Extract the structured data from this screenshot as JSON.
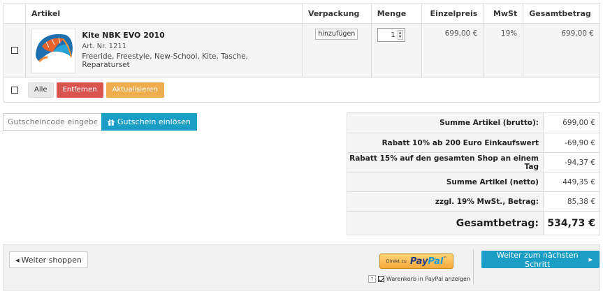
{
  "table": {
    "headers": {
      "article": "Artikel",
      "packaging": "Verpackung",
      "quantity": "Menge",
      "unit_price": "Einzelpreis",
      "vat": "MwSt",
      "total": "Gesamtbetrag"
    },
    "item": {
      "name": "Kite NBK EVO 2010",
      "article_nr": "Art. Nr. 1211",
      "tags": "Freeride, Freestyle, New-School, Kite, Tasche, Reparaturset",
      "packaging_button": "hinzufügen",
      "quantity": "1",
      "unit_price": "699,00 €",
      "vat": "19%",
      "total": "699,00 €"
    },
    "actions": {
      "all": "Alle",
      "remove": "Entfernen",
      "update": "Aktualisieren"
    }
  },
  "coupon": {
    "placeholder": "Gutscheincode eingeben",
    "button": "Gutschein einlösen"
  },
  "summary": [
    {
      "label": "Summe Artikel (brutto):",
      "value": "699,00 €"
    },
    {
      "label": "Rabatt  10% ab 200 Euro Einkaufswert",
      "value": "-69,90 €"
    },
    {
      "label": "Rabatt  15% auf den gesamten Shop an einem Tag",
      "value": "-94,37 €"
    },
    {
      "label": "Summe Artikel (netto)",
      "value": "449,35 €"
    },
    {
      "label": "zzgl. 19% MwSt., Betrag:",
      "value": "85,38 €"
    }
  ],
  "grand_total": {
    "label": "Gesamtbetrag:",
    "value": "534,73 €"
  },
  "bottom": {
    "continue_shopping": "Weiter shoppen",
    "paypal_direct": "Direkt zu",
    "paypal_pay": "Pay",
    "paypal_pal": "Pal",
    "paypal_checkbox_label": "Warenkorb in PayPal anzeigen",
    "help": "?",
    "next_step": "Weiter zum nächsten Schritt"
  },
  "colors": {
    "blue": "#1a9ec6",
    "red": "#d9534f",
    "orange": "#f0ad4e"
  }
}
